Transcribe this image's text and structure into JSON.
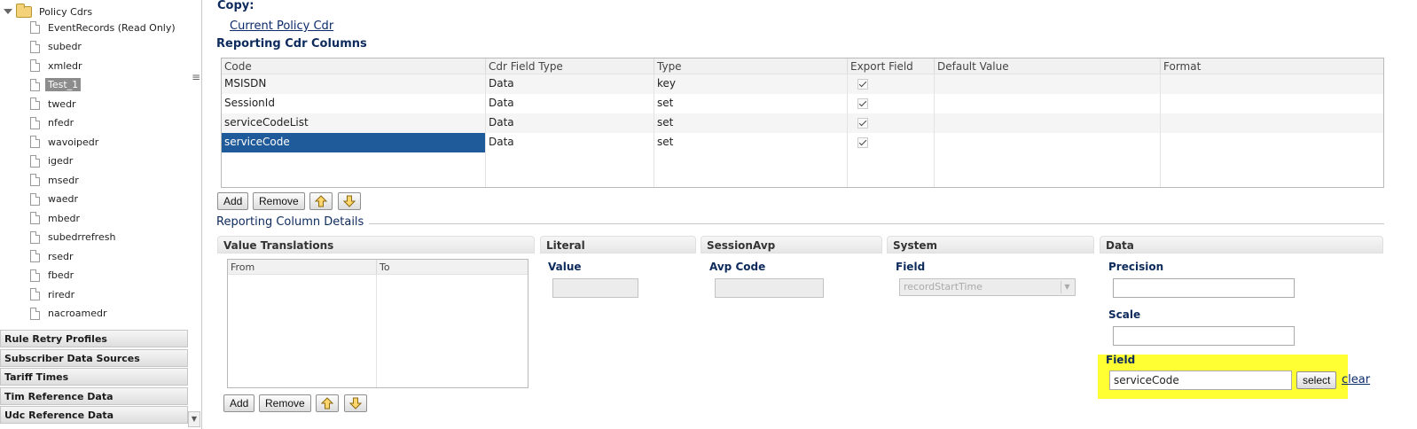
{
  "sidebar": {
    "root_label": "Policy Cdrs",
    "items": [
      {
        "label": "EventRecords (Read Only)",
        "selected": false
      },
      {
        "label": "subedr",
        "selected": false
      },
      {
        "label": "xmledr",
        "selected": false
      },
      {
        "label": "Test_1",
        "selected": true
      },
      {
        "label": "twedr",
        "selected": false
      },
      {
        "label": "nfedr",
        "selected": false
      },
      {
        "label": "wavoipedr",
        "selected": false
      },
      {
        "label": "igedr",
        "selected": false
      },
      {
        "label": "msedr",
        "selected": false
      },
      {
        "label": "waedr",
        "selected": false
      },
      {
        "label": "mbedr",
        "selected": false
      },
      {
        "label": "subedrrefresh",
        "selected": false
      },
      {
        "label": "rsedr",
        "selected": false
      },
      {
        "label": "fbedr",
        "selected": false
      },
      {
        "label": "riredr",
        "selected": false
      },
      {
        "label": "nacroamedr",
        "selected": false
      }
    ],
    "accordions": [
      "Rule Retry Profiles",
      "Subscriber Data Sources",
      "Tariff Times",
      "Tim Reference Data",
      "Udc Reference Data"
    ]
  },
  "main": {
    "copy_label": "Copy:",
    "copy_link": "Current Policy Cdr",
    "columns_title": "Reporting Cdr Columns",
    "columns_table": {
      "headers": [
        "Code",
        "Cdr Field Type",
        "Type",
        "Export Field",
        "Default Value",
        "Format"
      ],
      "rows": [
        {
          "code": "MSISDN",
          "field_type": "Data",
          "type": "key",
          "export": true,
          "default": "",
          "format": ""
        },
        {
          "code": "SessionId",
          "field_type": "Data",
          "type": "set",
          "export": true,
          "default": "",
          "format": ""
        },
        {
          "code": "serviceCodeList",
          "field_type": "Data",
          "type": "set",
          "export": true,
          "default": "",
          "format": ""
        },
        {
          "code": "serviceCode",
          "field_type": "Data",
          "type": "set",
          "export": true,
          "default": "",
          "format": ""
        }
      ],
      "selected_row": 3
    },
    "add_label": "Add",
    "remove_label": "Remove",
    "details_title": "Reporting Column Details",
    "panels": {
      "value_translations": {
        "title": "Value Translations",
        "headers": [
          "From",
          "To"
        ],
        "add_label": "Add",
        "remove_label": "Remove"
      },
      "literal": {
        "title": "Literal",
        "value_label": "Value",
        "value": ""
      },
      "session_avp": {
        "title": "SessionAvp",
        "avp_code_label": "Avp Code",
        "avp_code": ""
      },
      "system": {
        "title": "System",
        "field_label": "Field",
        "field_value": "recordStartTime"
      },
      "data": {
        "title": "Data",
        "precision_label": "Precision",
        "precision": "",
        "scale_label": "Scale",
        "scale": "",
        "field_label": "Field",
        "field_value": "serviceCode",
        "select_label": "select",
        "clear_label": "clear",
        "highlight_color": "#ffff33"
      }
    }
  },
  "colors": {
    "accent": "#1f5a9a",
    "heading": "#0d2a5c",
    "link": "#0b2a6b"
  }
}
